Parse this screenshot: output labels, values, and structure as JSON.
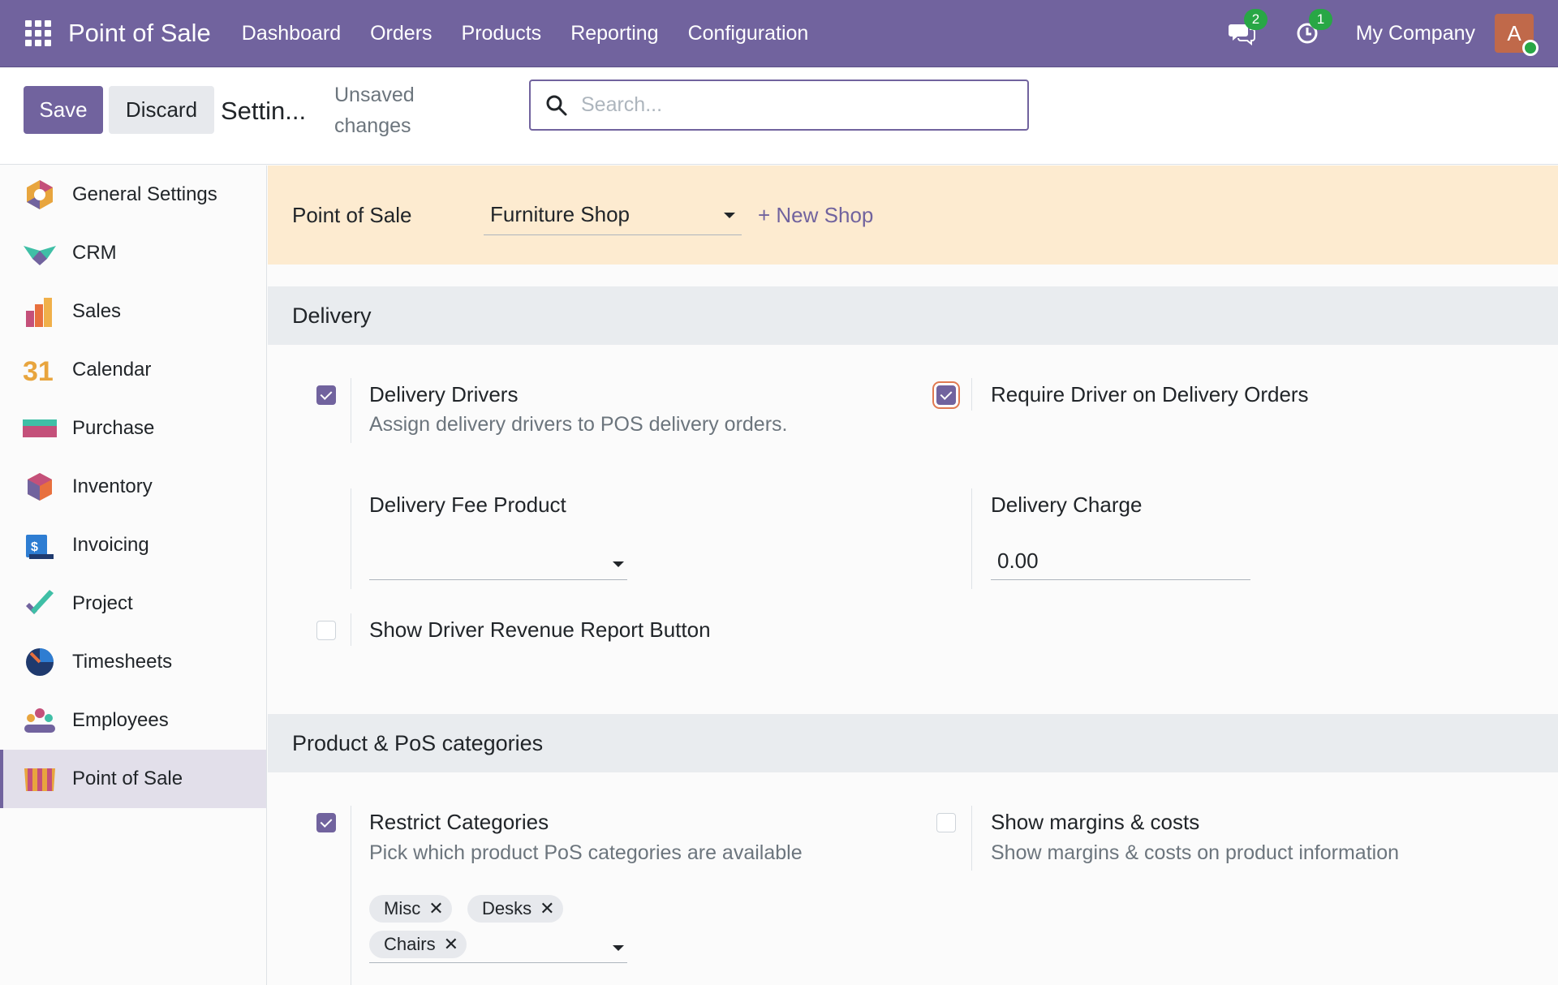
{
  "navbar": {
    "app_name": "Point of Sale",
    "menu": [
      "Dashboard",
      "Orders",
      "Products",
      "Reporting",
      "Configuration"
    ],
    "messages_count": "2",
    "activities_count": "1",
    "company": "My Company",
    "avatar_initial": "A"
  },
  "control": {
    "save_label": "Save",
    "discard_label": "Discard",
    "title": "Settin...",
    "status": "Unsaved changes",
    "search_placeholder": "Search..."
  },
  "sidebar": {
    "items": [
      {
        "label": "General Settings",
        "icon": "general-settings-icon"
      },
      {
        "label": "CRM",
        "icon": "crm-icon"
      },
      {
        "label": "Sales",
        "icon": "sales-icon"
      },
      {
        "label": "Calendar",
        "icon": "calendar-icon"
      },
      {
        "label": "Purchase",
        "icon": "purchase-icon"
      },
      {
        "label": "Inventory",
        "icon": "inventory-icon"
      },
      {
        "label": "Invoicing",
        "icon": "invoicing-icon"
      },
      {
        "label": "Project",
        "icon": "project-icon"
      },
      {
        "label": "Timesheets",
        "icon": "timesheets-icon"
      },
      {
        "label": "Employees",
        "icon": "employees-icon"
      },
      {
        "label": "Point of Sale",
        "icon": "point-of-sale-icon",
        "active": true
      }
    ],
    "calendar_icon_text": "31"
  },
  "shop": {
    "label": "Point of Sale",
    "selected": "Furniture Shop",
    "new_shop": "+ New Shop"
  },
  "delivery": {
    "heading": "Delivery",
    "drivers": {
      "title": "Delivery Drivers",
      "desc": "Assign delivery drivers to POS delivery orders.",
      "checked": true
    },
    "require_driver": {
      "title": "Require Driver on Delivery Orders",
      "checked": true
    },
    "fee_product": {
      "title": "Delivery Fee Product",
      "value": ""
    },
    "charge": {
      "title": "Delivery Charge",
      "value": "0.00"
    },
    "revenue_report": {
      "title": "Show Driver Revenue Report Button",
      "checked": false
    }
  },
  "categories": {
    "heading": "Product & PoS categories",
    "restrict": {
      "title": "Restrict Categories",
      "desc": "Pick which product PoS categories are available",
      "checked": true,
      "tags": [
        "Misc",
        "Desks",
        "Chairs"
      ]
    },
    "margins": {
      "title": "Show margins & costs",
      "desc": "Show margins & costs on product information",
      "checked": false
    }
  },
  "colors": {
    "brand": "#71639e",
    "shop_bar": "#fdebd0",
    "badge": "#28a745"
  }
}
